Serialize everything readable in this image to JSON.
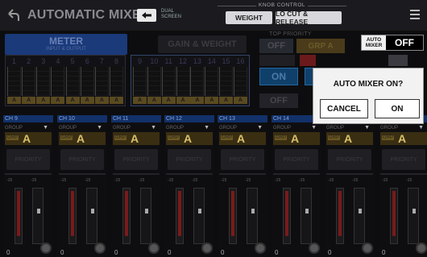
{
  "header": {
    "title": "AUTOMATIC MIXER",
    "dual_screen": "DUAL SCREEN",
    "knob_control_label": "KNOB CONTROL",
    "knob_weight": "WEIGHT",
    "knob_locut": "LO CUT & RELEASE"
  },
  "tabs": {
    "meter": "METER",
    "meter_sub": "INPUT & OUTPUT",
    "gain_weight": "GAIN & WEIGHT"
  },
  "meters": {
    "left_channels": [
      "1",
      "2",
      "3",
      "4",
      "5",
      "6",
      "7",
      "8"
    ],
    "right_channels": [
      "9",
      "10",
      "11",
      "12",
      "13",
      "14",
      "15",
      "16"
    ],
    "badge": "A"
  },
  "top_priority": {
    "label": "TOP PRIORITY",
    "off": "OFF",
    "group": "GRP A",
    "on": "ON",
    "off2": "OFF"
  },
  "auto_mixer": {
    "label_line1": "AUTO",
    "label_line2": "MIXER",
    "state": "OFF"
  },
  "dialog": {
    "message": "AUTO MIXER  ON?",
    "cancel": "CANCEL",
    "ok": "ON"
  },
  "strips": [
    {
      "name": "CH 9",
      "group": "A"
    },
    {
      "name": "CH 10",
      "group": "A"
    },
    {
      "name": "CH 11",
      "group": "A"
    },
    {
      "name": "CH 12",
      "group": "A"
    },
    {
      "name": "CH 13",
      "group": "A"
    },
    {
      "name": "CH 14",
      "group": "A"
    },
    {
      "name": "",
      "group": "A"
    },
    {
      "name": "",
      "group": "A"
    }
  ],
  "strip_labels": {
    "group": "GROUP",
    "grp": "GRP",
    "priority": "PRIORITY",
    "scale_15": "-15",
    "zero": "0"
  }
}
